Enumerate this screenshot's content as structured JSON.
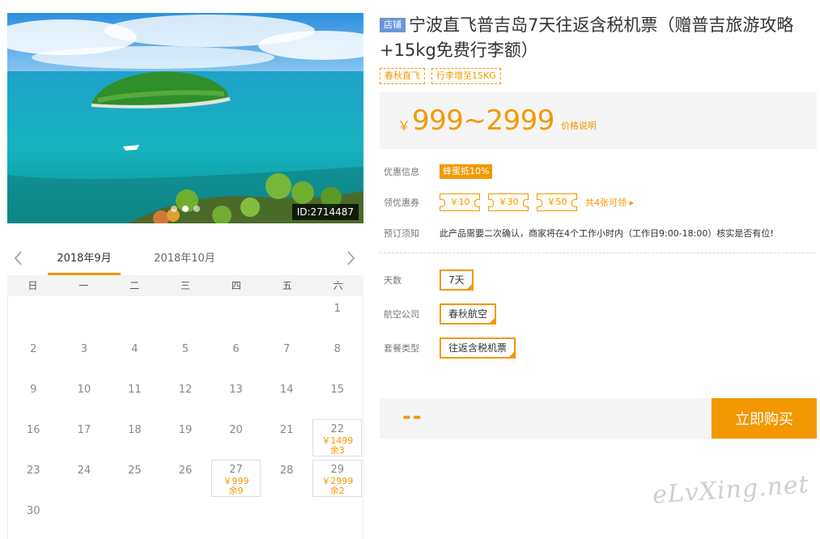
{
  "hero": {
    "image_id": "ID:2714487",
    "dots": 3,
    "active_dot": 1
  },
  "calendar": {
    "months": [
      "2018年9月",
      "2018年10月"
    ],
    "active_month": 0,
    "weekdays": [
      "日",
      "一",
      "二",
      "三",
      "四",
      "五",
      "六"
    ],
    "days": [
      {
        "d": "",
        "p": "",
        "s": ""
      },
      {
        "d": "",
        "p": "",
        "s": ""
      },
      {
        "d": "",
        "p": "",
        "s": ""
      },
      {
        "d": "",
        "p": "",
        "s": ""
      },
      {
        "d": "",
        "p": "",
        "s": ""
      },
      {
        "d": "",
        "p": "",
        "s": ""
      },
      {
        "d": "1",
        "p": "",
        "s": ""
      },
      {
        "d": "2",
        "p": "",
        "s": ""
      },
      {
        "d": "3",
        "p": "",
        "s": ""
      },
      {
        "d": "4",
        "p": "",
        "s": ""
      },
      {
        "d": "5",
        "p": "",
        "s": ""
      },
      {
        "d": "6",
        "p": "",
        "s": ""
      },
      {
        "d": "7",
        "p": "",
        "s": ""
      },
      {
        "d": "8",
        "p": "",
        "s": ""
      },
      {
        "d": "9",
        "p": "",
        "s": ""
      },
      {
        "d": "10",
        "p": "",
        "s": ""
      },
      {
        "d": "11",
        "p": "",
        "s": ""
      },
      {
        "d": "12",
        "p": "",
        "s": ""
      },
      {
        "d": "13",
        "p": "",
        "s": ""
      },
      {
        "d": "14",
        "p": "",
        "s": ""
      },
      {
        "d": "15",
        "p": "",
        "s": ""
      },
      {
        "d": "16",
        "p": "",
        "s": ""
      },
      {
        "d": "17",
        "p": "",
        "s": ""
      },
      {
        "d": "18",
        "p": "",
        "s": ""
      },
      {
        "d": "19",
        "p": "",
        "s": ""
      },
      {
        "d": "20",
        "p": "",
        "s": ""
      },
      {
        "d": "21",
        "p": "",
        "s": ""
      },
      {
        "d": "22",
        "p": "￥1499",
        "s": "余3"
      },
      {
        "d": "23",
        "p": "",
        "s": ""
      },
      {
        "d": "24",
        "p": "",
        "s": ""
      },
      {
        "d": "25",
        "p": "",
        "s": ""
      },
      {
        "d": "26",
        "p": "",
        "s": ""
      },
      {
        "d": "27",
        "p": "￥999",
        "s": "余9"
      },
      {
        "d": "28",
        "p": "",
        "s": ""
      },
      {
        "d": "29",
        "p": "￥2999",
        "s": "余2"
      },
      {
        "d": "30",
        "p": "",
        "s": ""
      }
    ]
  },
  "product": {
    "shop_badge": "店铺",
    "title": "宁波直飞普吉岛7天往返含税机票（赠普吉旅游攻略+15kg免费行李额）",
    "tags": [
      "春秋直飞",
      "行李增至15KG"
    ],
    "price_currency": "￥",
    "price_range": "999~2999",
    "price_note": "价格说明"
  },
  "promo": {
    "label": "优惠信息",
    "badge": "蜂蜜抵10%"
  },
  "coupons": {
    "label": "领优惠券",
    "items": [
      "￥10",
      "￥30",
      "￥50"
    ],
    "more": "共4张可领 ▸"
  },
  "notice": {
    "label": "预订须知",
    "text": "此产品需要二次确认，商家将在4个工作小时内（工作日9:00-18:00）核实是否有位!"
  },
  "options": {
    "days_label": "天数",
    "days_value": "7天",
    "airline_label": "航空公司",
    "airline_value": "春秋航空",
    "package_label": "套餐类型",
    "package_value": "往返含税机票"
  },
  "buy": {
    "total": "--",
    "button": "立即购买"
  },
  "watermark": "eLvXing.net",
  "colors": {
    "accent": "#f39800",
    "badge_blue": "#6a96d8"
  }
}
